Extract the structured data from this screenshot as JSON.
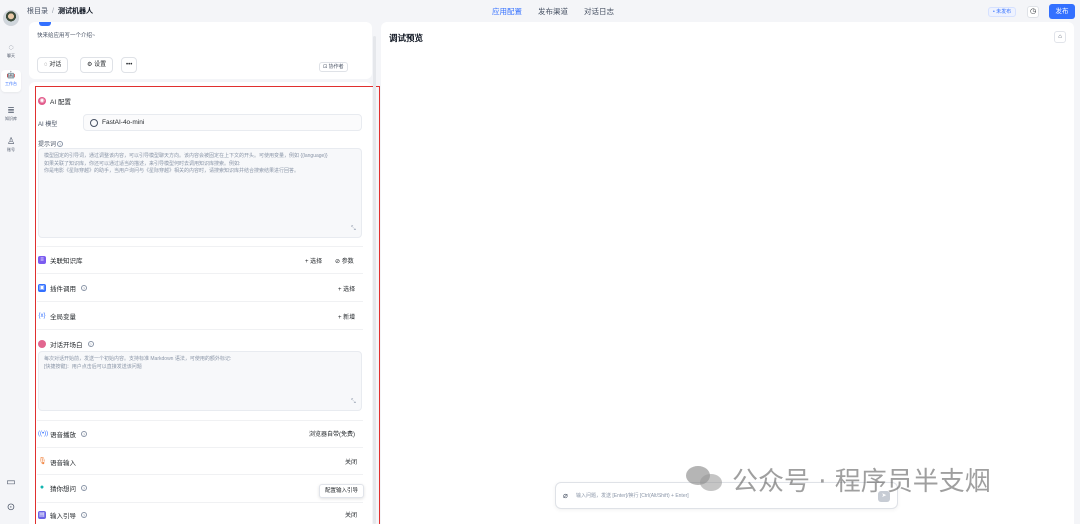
{
  "rail": {
    "items": [
      {
        "icon": "chat-icon",
        "glyph": "◌",
        "label": "聊天"
      },
      {
        "icon": "robot-icon",
        "glyph": "🤖",
        "label": "工作台"
      },
      {
        "icon": "database-icon",
        "glyph": "≣",
        "label": "知识库"
      },
      {
        "icon": "user-icon",
        "glyph": "♙",
        "label": "账号"
      }
    ],
    "book_glyph": "▭",
    "github_glyph": "⊙"
  },
  "topbar": {
    "breadcrumb_root": "根目录",
    "breadcrumb_sep": "/",
    "breadcrumb_current": "测试机器人",
    "tabs": [
      "应用配置",
      "发布渠道",
      "对话日志"
    ],
    "status": "• 未发布",
    "clock_glyph": "◷",
    "publish_label": "发布"
  },
  "app_card": {
    "intro": "快来给应用写一个介绍~",
    "chat_button": "对话",
    "settings_button": "设置",
    "more_button": "•••",
    "collab_button": "协作者"
  },
  "config": {
    "ai_title": "AI 配置",
    "model_label": "AI 模型",
    "model_value": "FastAI-4o-mini",
    "prompt_label": "提示词",
    "prompt_placeholder": "模型固定的引导词，通过调整该内容，可以引导模型聊天方向。该内容会被固定在上下文的开头。可使用变量，例如 {{language}}\n如果关联了知识库，你还可以通过适当的描述，来引导模型何时去调用知识库搜索。例如:\n你是电影《星际穿越》的助手，当用户询问与《星际穿越》相关的内容时，请搜索知识库并结合搜索结果进行回答。",
    "kb_title": "关联知识库",
    "kb_select": "+ 选择",
    "kb_params": "⊘ 参数",
    "plugin_title": "插件调用",
    "plugin_select": "+ 选择",
    "var_title": "全局变量",
    "var_add": "+ 新增",
    "opener_title": "对话开场白",
    "opener_placeholder": "每次对话开始前，发送一个初始内容。支持标准 Markdown 语法，可使用的额外标记:\n[快捷按键]：用户点击后可以直接发送该问题",
    "tts_title": "语音播放",
    "tts_value": "浏览器自带(免费)",
    "stt_title": "语音输入",
    "stt_value": "关闭",
    "guess_title": "猜你想问",
    "guess_tooltip": "配置输入引导",
    "guide_title": "输入引导",
    "guide_value": "关闭",
    "resize_glyph": "⤡"
  },
  "preview": {
    "title": "调试预览",
    "trash_glyph": "⌂",
    "input_placeholder": "输入问题，发送 [Enter]/换行 [Ctrl(Alt/Shift) + Enter]",
    "clip_glyph": "⌀",
    "send_glyph": "➤"
  },
  "watermark": {
    "text": "公众号 · 程序员半支烟"
  },
  "colors": {
    "accent": "#3370ff",
    "highlight_border": "#e0302f"
  }
}
